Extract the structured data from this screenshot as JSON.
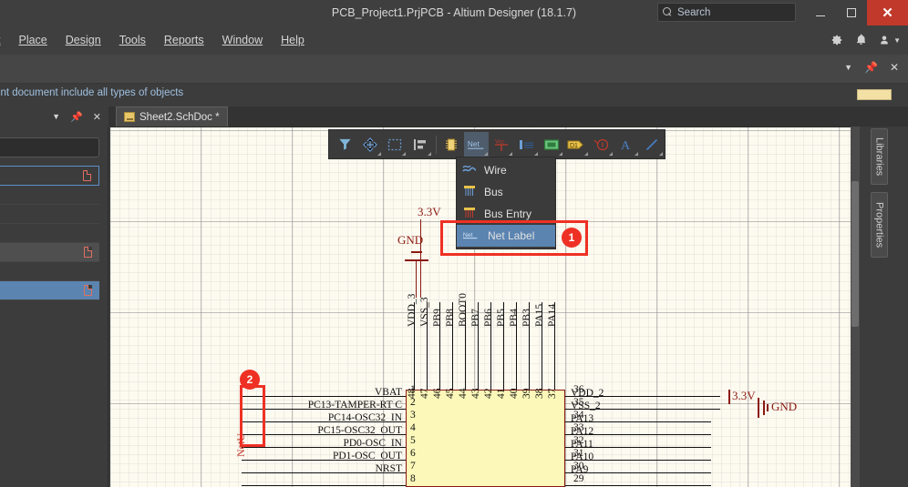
{
  "window": {
    "title": "PCB_Project1.PrjPCB - Altium Designer (18.1.7)",
    "minimize_label": "",
    "maximize_label": "",
    "close_label": "✕"
  },
  "search": {
    "placeholder": "Search",
    "icon": "search-icon"
  },
  "menu": {
    "items": [
      {
        "label": "t",
        "accel": ""
      },
      {
        "label": "Place",
        "accel": "P"
      },
      {
        "label": "Design",
        "accel": "D"
      },
      {
        "label": "Tools",
        "accel": "T"
      },
      {
        "label": "Reports",
        "accel": "R"
      },
      {
        "label": "Window",
        "accel": "W"
      },
      {
        "label": "Help",
        "accel": "H"
      }
    ],
    "right_icons": [
      "gear-icon",
      "bell-icon",
      "user-icon",
      "chevron-down-icon"
    ]
  },
  "strip": {
    "controls": [
      "chevron-down-icon",
      "pin-icon",
      "close-icon"
    ]
  },
  "query": {
    "text": "urrent document include all types of objects",
    "swatch_color": "#f3e0a4"
  },
  "tabs": {
    "document": {
      "label": "Sheet2.SchDoc *",
      "icon": "schematic-doc-icon"
    }
  },
  "left_panel": {
    "header_controls": [
      "chevron-down-icon",
      "pin-icon",
      "close-icon"
    ],
    "rows": [
      {
        "state": "outlined",
        "icon": "document-icon"
      },
      {
        "state": "plain",
        "icon": ""
      },
      {
        "state": "plain",
        "icon": ""
      },
      {
        "state": "plain",
        "icon": ""
      },
      {
        "state": "hover",
        "icon": "document-icon"
      },
      {
        "state": "plain",
        "icon": ""
      },
      {
        "state": "selected",
        "icon": "document-icon"
      }
    ]
  },
  "toolbar": {
    "buttons": [
      {
        "name": "filter-icon",
        "caret": false,
        "active": false
      },
      {
        "name": "crosshair-move-icon",
        "caret": true,
        "active": false
      },
      {
        "name": "selection-rect-icon",
        "caret": true,
        "active": false
      },
      {
        "name": "align-icon",
        "caret": true,
        "active": false
      },
      {
        "name": "ic-component-icon",
        "caret": false,
        "active": false
      },
      {
        "name": "net-label-icon",
        "caret": true,
        "active": true,
        "label": "Net"
      },
      {
        "name": "power-port-vcc-icon",
        "caret": true,
        "active": false,
        "label": "Vcc"
      },
      {
        "name": "port-icon",
        "caret": true,
        "active": false
      },
      {
        "name": "sheet-symbol-icon",
        "caret": true,
        "active": false
      },
      {
        "name": "designator-icon",
        "caret": true,
        "active": false,
        "label": "D1"
      },
      {
        "name": "no-erc-icon",
        "caret": true,
        "active": false
      },
      {
        "name": "text-string-icon",
        "caret": true,
        "active": false,
        "label": "A"
      },
      {
        "name": "line-icon",
        "caret": true,
        "active": false
      }
    ]
  },
  "dropdown": {
    "items": [
      {
        "label": "Wire",
        "icon": "wire-icon",
        "selected": false
      },
      {
        "label": "Bus",
        "icon": "bus-icon",
        "selected": false
      },
      {
        "label": "Bus Entry",
        "icon": "bus-entry-icon",
        "selected": false
      },
      {
        "label": "Net Label",
        "icon": "net-label-icon",
        "selected": true
      }
    ]
  },
  "annotations": [
    {
      "number": "1",
      "target": "net-label-menu-item"
    },
    {
      "number": "2",
      "target": "placed-net-label"
    }
  ],
  "right_sidebar": {
    "tabs": [
      {
        "label": "Libraries"
      },
      {
        "label": "Properties"
      }
    ]
  },
  "schematic": {
    "placed_net_label": "NetU",
    "top_pins": [
      {
        "num": "48",
        "name": "VDD_3"
      },
      {
        "num": "47",
        "name": "VSS_3"
      },
      {
        "num": "46",
        "name": "PB9"
      },
      {
        "num": "45",
        "name": "PB8"
      },
      {
        "num": "44",
        "name": "BOOT0"
      },
      {
        "num": "43",
        "name": "PB7"
      },
      {
        "num": "42",
        "name": "PB6"
      },
      {
        "num": "41",
        "name": "PB5"
      },
      {
        "num": "40",
        "name": "PB4"
      },
      {
        "num": "39",
        "name": "PB3"
      },
      {
        "num": "38",
        "name": "PA15"
      },
      {
        "num": "37",
        "name": "PA14"
      }
    ],
    "left_pins": [
      {
        "num": "1",
        "name": "VBAT"
      },
      {
        "num": "2",
        "name": "PC13-TAMPER-RT C"
      },
      {
        "num": "3",
        "name": "PC14-OSC32_IN"
      },
      {
        "num": "4",
        "name": "PC15-OSC32_OUT"
      },
      {
        "num": "5",
        "name": "PD0-OSC_IN"
      },
      {
        "num": "6",
        "name": "PD1-OSC_OUT"
      },
      {
        "num": "7",
        "name": "NRST"
      },
      {
        "num": "8",
        "name": ""
      }
    ],
    "right_pins": [
      {
        "num": "36",
        "name": "VDD_2"
      },
      {
        "num": "35",
        "name": "VSS_2"
      },
      {
        "num": "34",
        "name": "PA13"
      },
      {
        "num": "33",
        "name": "PA12"
      },
      {
        "num": "32",
        "name": "PA11"
      },
      {
        "num": "31",
        "name": "PA10"
      },
      {
        "num": "30",
        "name": "PA9"
      },
      {
        "num": "29",
        "name": ""
      }
    ],
    "power_ports": [
      {
        "label": "3.3V",
        "position": "top-left"
      },
      {
        "label": "GND",
        "position": "top-left-lower"
      },
      {
        "label": "3.3V",
        "position": "right-upper"
      },
      {
        "label": "GND",
        "position": "right-lower"
      }
    ],
    "chip_fill": "#fbf8b9",
    "chip_border": "#8b1a10"
  }
}
